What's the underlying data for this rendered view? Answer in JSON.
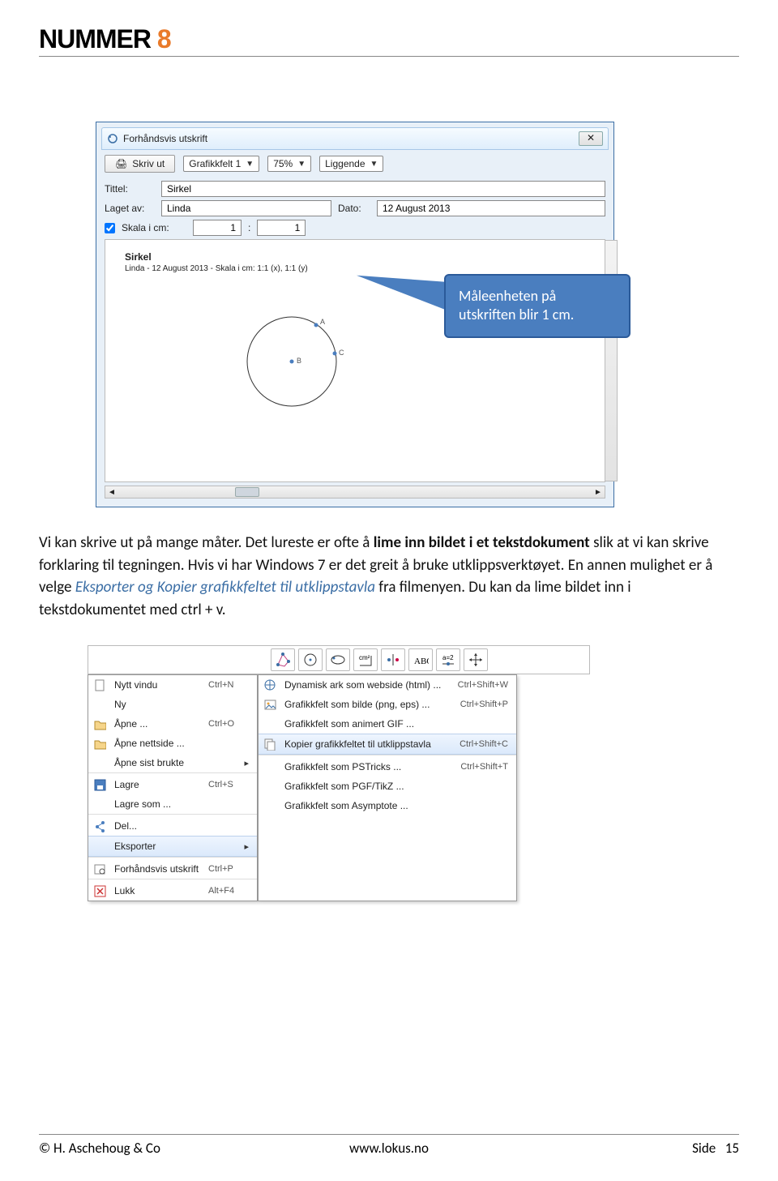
{
  "logo": {
    "brand": "NUMMER ",
    "accent": "8"
  },
  "dialog": {
    "title": "Forhåndsvis utskrift",
    "print_btn": "Skriv ut",
    "field_dd": "Grafikkfelt 1",
    "zoom_dd": "75%",
    "orient_dd": "Liggende",
    "close": "✕",
    "tittel_label": "Tittel:",
    "tittel_value": "Sirkel",
    "laget_label": "Laget av:",
    "laget_value": "Linda",
    "dato_label": "Dato:",
    "dato_value": "12 August 2013",
    "skala_label": "Skala i cm:",
    "skala_x": "1",
    "skala_sep": ":",
    "skala_y": "1",
    "preview_title": "Sirkel",
    "preview_sub": "Linda - 12 August 2013 - Skala i cm: 1:1 (x), 1:1 (y)"
  },
  "callout": "Måleenheten på utskriften blir 1 cm.",
  "body": {
    "t1": "Vi kan skrive ut på mange måter. Det lureste er ofte å ",
    "b1": "lime inn bildet i et tekstdokument",
    "t2": " slik at vi kan skrive forklaring til tegningen. Hvis vi har Windows 7 er det greit å bruke utklippsverktøyet. En annen mulighet er å velge ",
    "i1": "Eksporter og Kopier grafikkfeltet til utklippstavla",
    "t3": " fra filmenyen. Du kan da lime bildet inn i tekstdokumentet med ctrl + v."
  },
  "menu": {
    "items": [
      {
        "label": "Nytt vindu",
        "short": "Ctrl+N",
        "icon": "new"
      },
      {
        "label": "Ny",
        "short": "",
        "icon": ""
      },
      {
        "label": "Åpne ...",
        "short": "Ctrl+O",
        "icon": "open"
      },
      {
        "label": "Åpne nettside ...",
        "short": "",
        "icon": "open"
      },
      {
        "label": "Åpne sist brukte",
        "short": "",
        "icon": "",
        "arrow": true
      },
      {
        "sep": true
      },
      {
        "label": "Lagre",
        "short": "Ctrl+S",
        "icon": "save"
      },
      {
        "label": "Lagre som ...",
        "short": "",
        "icon": ""
      },
      {
        "sep": true
      },
      {
        "label": "Del...",
        "short": "",
        "icon": "share"
      },
      {
        "label": "Eksporter",
        "short": "",
        "icon": "",
        "arrow": true,
        "hl": true
      },
      {
        "sep": true
      },
      {
        "label": "Forhåndsvis utskrift",
        "short": "Ctrl+P",
        "icon": "preview"
      },
      {
        "sep": true
      },
      {
        "label": "Lukk",
        "short": "Alt+F4",
        "icon": "close"
      }
    ],
    "sub": [
      {
        "label": "Dynamisk ark som webside (html) ...",
        "short": "Ctrl+Shift+W",
        "icon": "web"
      },
      {
        "label": "Grafikkfelt som bilde (png, eps) ...",
        "short": "Ctrl+Shift+P",
        "icon": "img"
      },
      {
        "label": "Grafikkfelt som animert GIF ...",
        "short": "",
        "icon": ""
      },
      {
        "label": "Kopier grafikkfeltet til utklippstavla",
        "short": "Ctrl+Shift+C",
        "icon": "copy",
        "hl": true
      },
      {
        "sep": true
      },
      {
        "label": "Grafikkfelt som PSTricks ...",
        "short": "Ctrl+Shift+T",
        "icon": ""
      },
      {
        "label": "Grafikkfelt som PGF/TikZ ...",
        "short": "",
        "icon": ""
      },
      {
        "label": "Grafikkfelt som Asymptote ...",
        "short": "",
        "icon": ""
      }
    ]
  },
  "footer": {
    "left": "© H. Aschehoug & Co",
    "mid": "www.lokus.no",
    "right_label": "Side",
    "right_page": "15"
  }
}
